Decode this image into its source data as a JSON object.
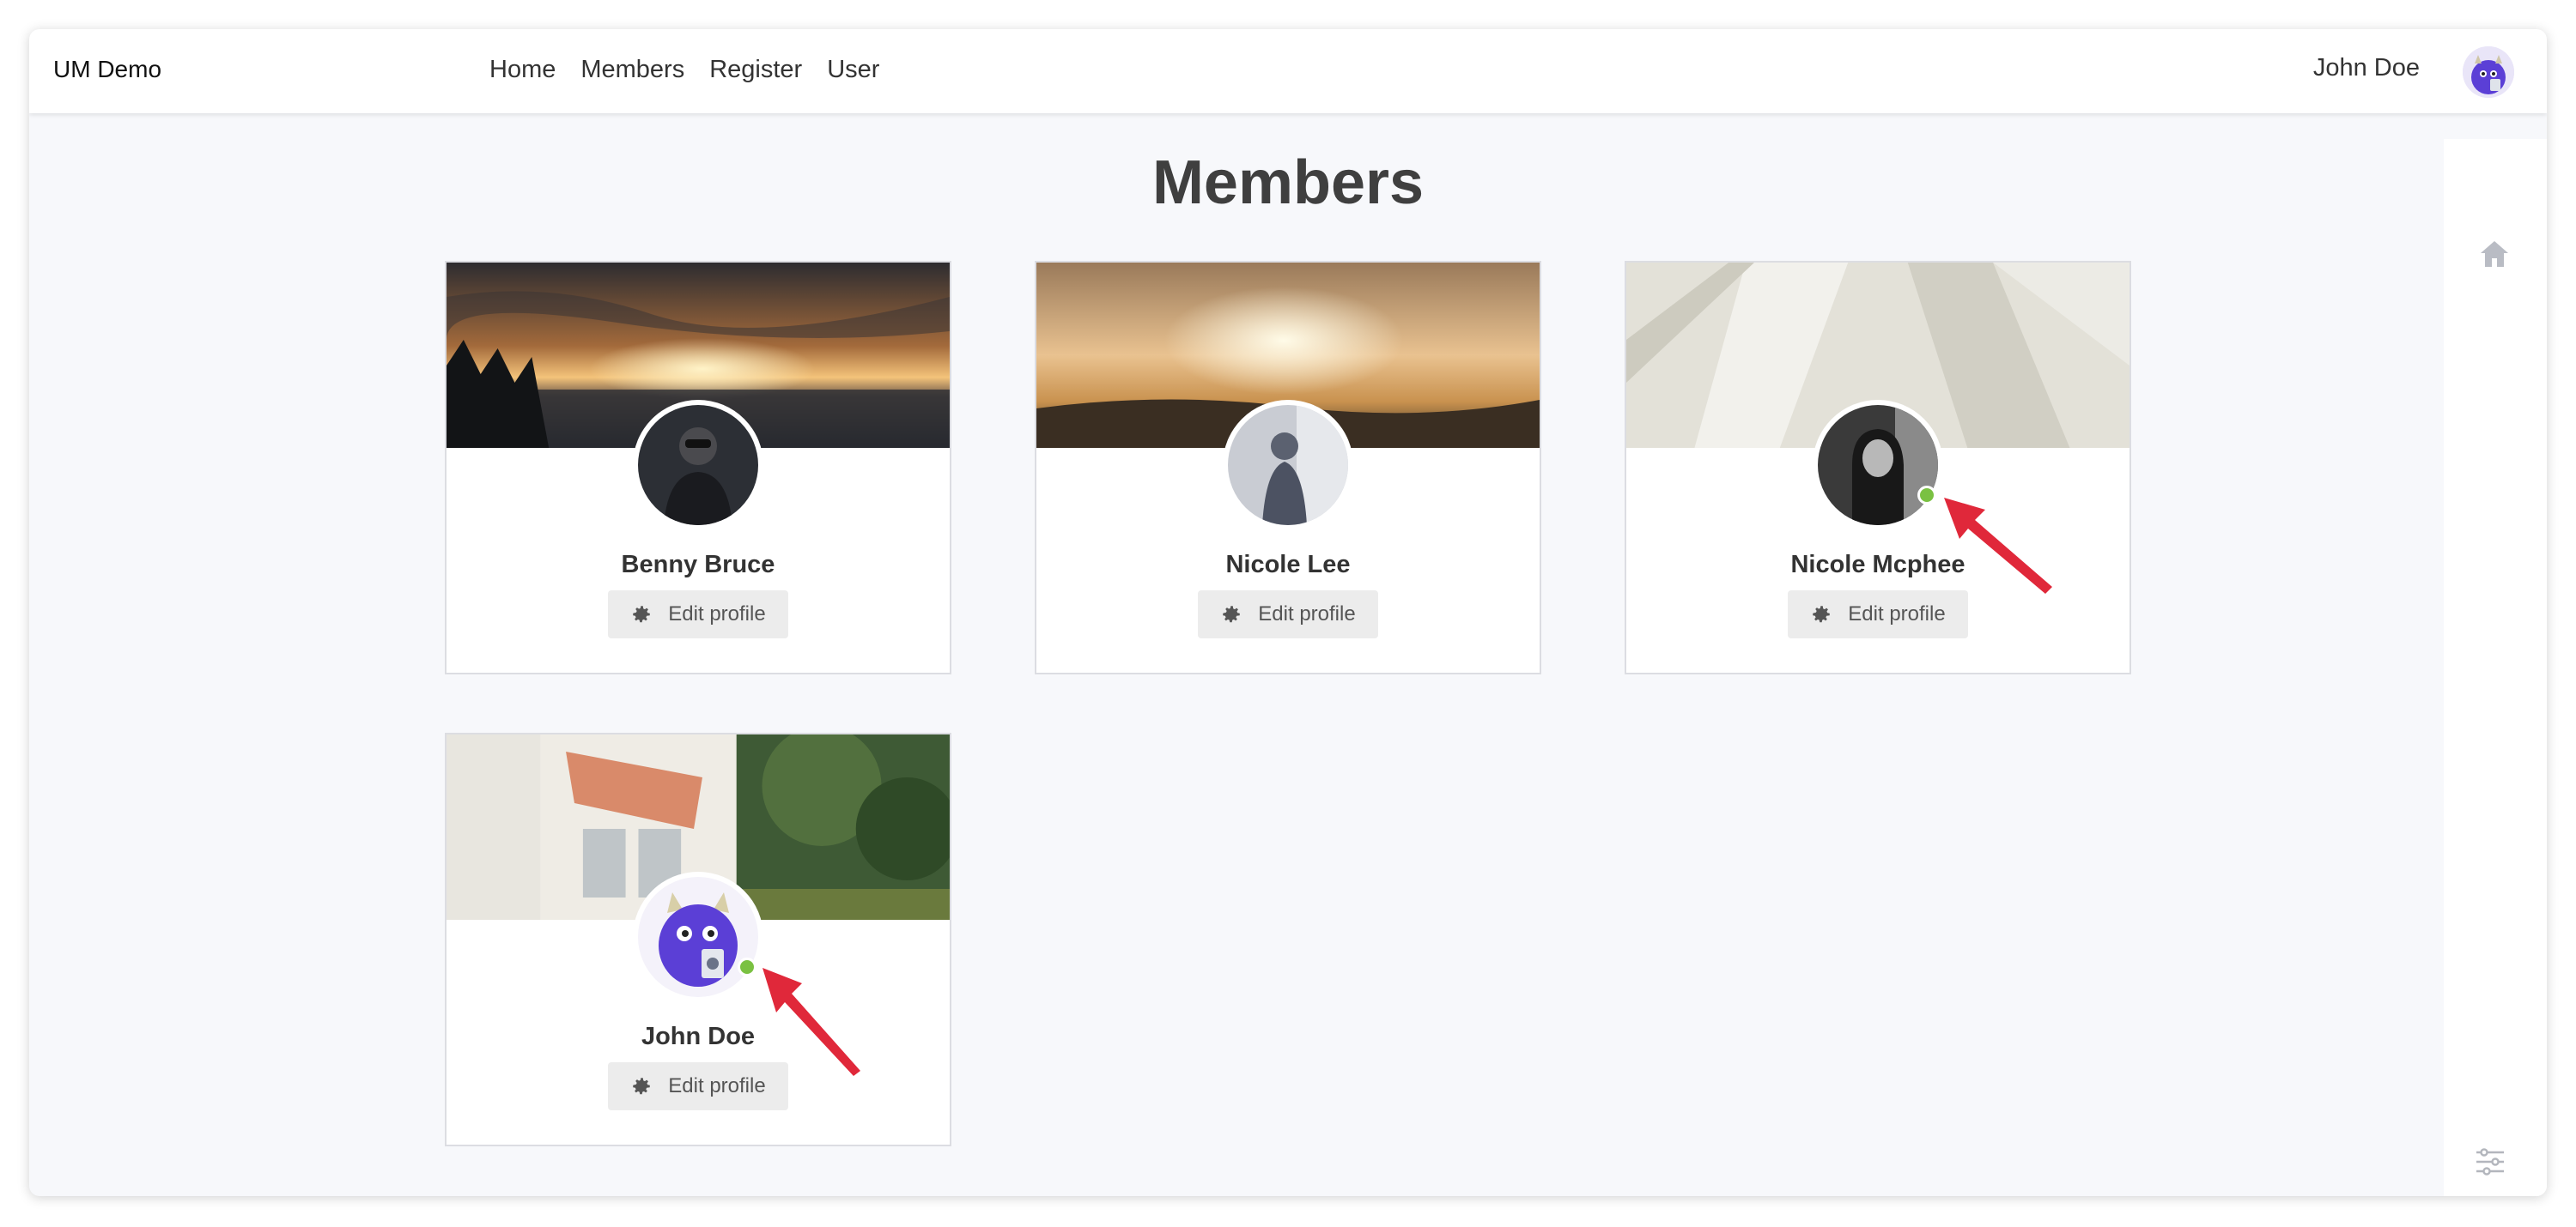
{
  "app": {
    "brand": "UM Demo"
  },
  "nav": {
    "items": [
      "Home",
      "Members",
      "Register",
      "User"
    ]
  },
  "current_user": {
    "name": "John Doe"
  },
  "page": {
    "title": "Members"
  },
  "members": [
    {
      "name": "Benny Bruce",
      "edit_label": "Edit profile",
      "online": false
    },
    {
      "name": "Nicole Lee",
      "edit_label": "Edit profile",
      "online": false
    },
    {
      "name": "Nicole Mcphee",
      "edit_label": "Edit profile",
      "online": true
    },
    {
      "name": "John Doe",
      "edit_label": "Edit profile",
      "online": true
    }
  ],
  "colors": {
    "online": "#7ac142",
    "annotation_arrow": "#e0283a",
    "avatar_purple": "#5b3fd6"
  },
  "icons": [
    "gear-icon",
    "home-icon",
    "sliders-icon"
  ]
}
